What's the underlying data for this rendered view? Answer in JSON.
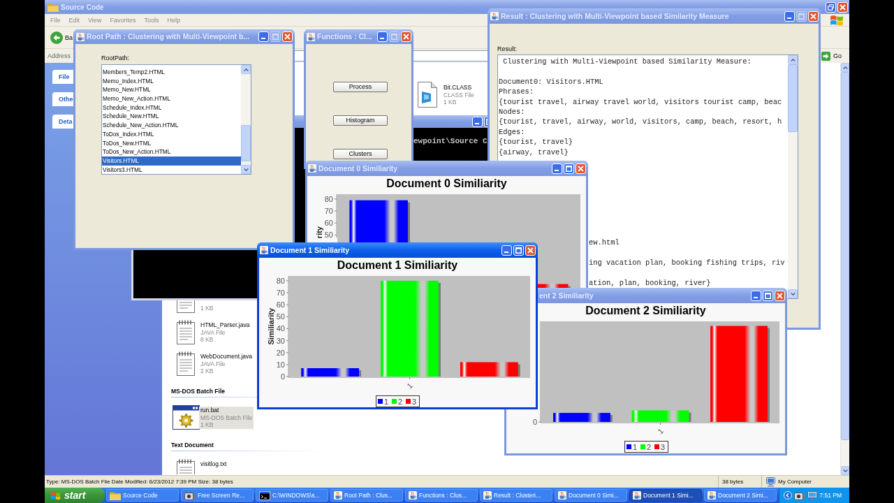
{
  "explorer": {
    "title": "Source Code",
    "active": false,
    "menu": [
      "File",
      "Edit",
      "View",
      "Favorites",
      "Tools",
      "Help"
    ],
    "back": "Ba",
    "address_label": "Address",
    "go": "Go",
    "task_pane": [
      "File",
      "Othe",
      "Deta"
    ],
    "tile": {
      "name": "Bit.CLASS",
      "type": "CLASS File",
      "size": "1 KB",
      "kind": "class",
      "selected": false
    },
    "groups": [
      {
        "items": [
          {
            "size": "1 KB",
            "kind": "document",
            "selected": false
          },
          {
            "name": "HTML_Parser.java",
            "type": "JAVA File",
            "size": "8 KB",
            "kind": "document",
            "selected": false
          },
          {
            "name": "WebDocument.java",
            "type": "JAVA File",
            "size": "2 KB",
            "kind": "document",
            "selected": false
          }
        ]
      },
      {
        "header": "MS-DOS Batch File",
        "items": [
          {
            "name": "run.bat",
            "type": "MS-DOS Batch File",
            "size": "1 KB",
            "kind": "batch",
            "selected": true
          }
        ]
      },
      {
        "header": "Text Document",
        "items": [
          {
            "name": "visitlog.txt",
            "kind": "document",
            "selected": false
          }
        ]
      }
    ],
    "status": {
      "text": "Type: MS-DOS Batch File Date Modified: 6/23/2012 7:39 PM Size: 38 bytes",
      "size": "38 bytes",
      "zone": "My Computer"
    }
  },
  "console": {
    "active": false,
    "text": "ewpoint\\Source C"
  },
  "root_path": {
    "title": "Root Path : Clustering with Multi-Viewpoint b...",
    "active": false,
    "can_maximize": false,
    "label": "RootPath:",
    "items": [
      {
        "label": "Members_Temp2.HTML",
        "selected": false
      },
      {
        "label": "Memo_Index.HTML",
        "selected": false
      },
      {
        "label": "Memo_New.HTML",
        "selected": false
      },
      {
        "label": "Memo_New_Action.HTML",
        "selected": false
      },
      {
        "label": "Schedule_Index.HTML",
        "selected": false
      },
      {
        "label": "Schedule_New.HTML",
        "selected": false
      },
      {
        "label": "Schedule_New_Action.HTML",
        "selected": false
      },
      {
        "label": "ToDos_Index.HTML",
        "selected": false
      },
      {
        "label": "ToDos_New.HTML",
        "selected": false
      },
      {
        "label": "ToDos_New_Action.HTML",
        "selected": false
      },
      {
        "label": "Visitors.HTML",
        "selected": true
      },
      {
        "label": "Visitors3.HTML",
        "selected": false
      }
    ]
  },
  "functions": {
    "title": "Functions : Cl...",
    "active": false,
    "can_maximize": false,
    "buttons": [
      "Process",
      "Histogram",
      "Clusters"
    ]
  },
  "result": {
    "title": "Result : Clustering with Multi-Viewpoint based Similarity Measure",
    "active": false,
    "can_maximize": false,
    "label": "Result:",
    "heading": " Clustering with Multi-Viewpoint based Similarity Measure:",
    "lines": [
      "Document0: Visitors.HTML",
      "Phrases:",
      "{tourist travel, airway travel world, visitors tourist camp, beac",
      "Nodes:",
      "{tourist, travel, airway, world, visitors, camp, beach, resort, h",
      "Edges:",
      "{tourist, travel}",
      "{airway, travel}"
    ],
    "cut_lines": [
      "ew.html",
      "ing vacation plan, booking fishing trips, riv",
      "ation, plan, booking, river}"
    ]
  },
  "similarity_windows": [
    {
      "title": "Document 0 Similiarity",
      "active": false,
      "can_maximize": true,
      "chart": {
        "title": "Document 0 Similiarity",
        "axis_title": "rity",
        "ytick_labels": [
          "80",
          "70",
          "60",
          "50"
        ]
      }
    },
    {
      "title": "Document 1 Similiarity",
      "active": true,
      "can_maximize": true,
      "chart_data": {
        "type": "bar",
        "title": "Document 1 Similiarity",
        "ylabel": "Similiarity",
        "categories": [
          "1"
        ],
        "ylim": [
          0,
          84
        ],
        "yticks": [
          0,
          10,
          20,
          30,
          40,
          50,
          60,
          70,
          80
        ],
        "legend": "bottom",
        "series": [
          {
            "name": "1",
            "color": "#0000ff",
            "values": [
              7
            ]
          },
          {
            "name": "2",
            "color": "#00ff00",
            "values": [
              80
            ]
          },
          {
            "name": "3",
            "color": "#ff0000",
            "values": [
              12
            ]
          }
        ]
      }
    },
    {
      "title": "ent 2 Similiarity",
      "active": false,
      "can_maximize": true,
      "chart": {
        "title": "Document 2 Similiarity",
        "ytick_labels": [
          "0"
        ],
        "category_labels": [
          "1"
        ],
        "legend": [
          {
            "label": "1",
            "color": "#0000ff"
          },
          {
            "label": "2",
            "color": "#00ff00"
          },
          {
            "label": "3",
            "color": "#ff0000"
          }
        ]
      }
    }
  ],
  "taskbar": {
    "start": "start",
    "items": [
      {
        "label": "Source Code",
        "kind": "folder",
        "selected": false
      },
      {
        "label": "Free Screen Re...",
        "kind": "camera",
        "selected": false
      },
      {
        "label": "C:\\WINDOWS\\s...",
        "kind": "console",
        "selected": false
      },
      {
        "label": "Root Path : Clus...",
        "kind": "java",
        "selected": false
      },
      {
        "label": "Functions : Clus...",
        "kind": "java",
        "selected": false
      },
      {
        "label": "Result : Clusteri...",
        "kind": "java",
        "selected": false
      },
      {
        "label": "Document 0 Simi...",
        "kind": "java",
        "selected": false
      },
      {
        "label": "Document 1 Simi...",
        "kind": "java",
        "selected": true
      },
      {
        "label": "Document 2 Simi...",
        "kind": "java",
        "selected": false
      }
    ],
    "clock": "7:51 PM"
  }
}
